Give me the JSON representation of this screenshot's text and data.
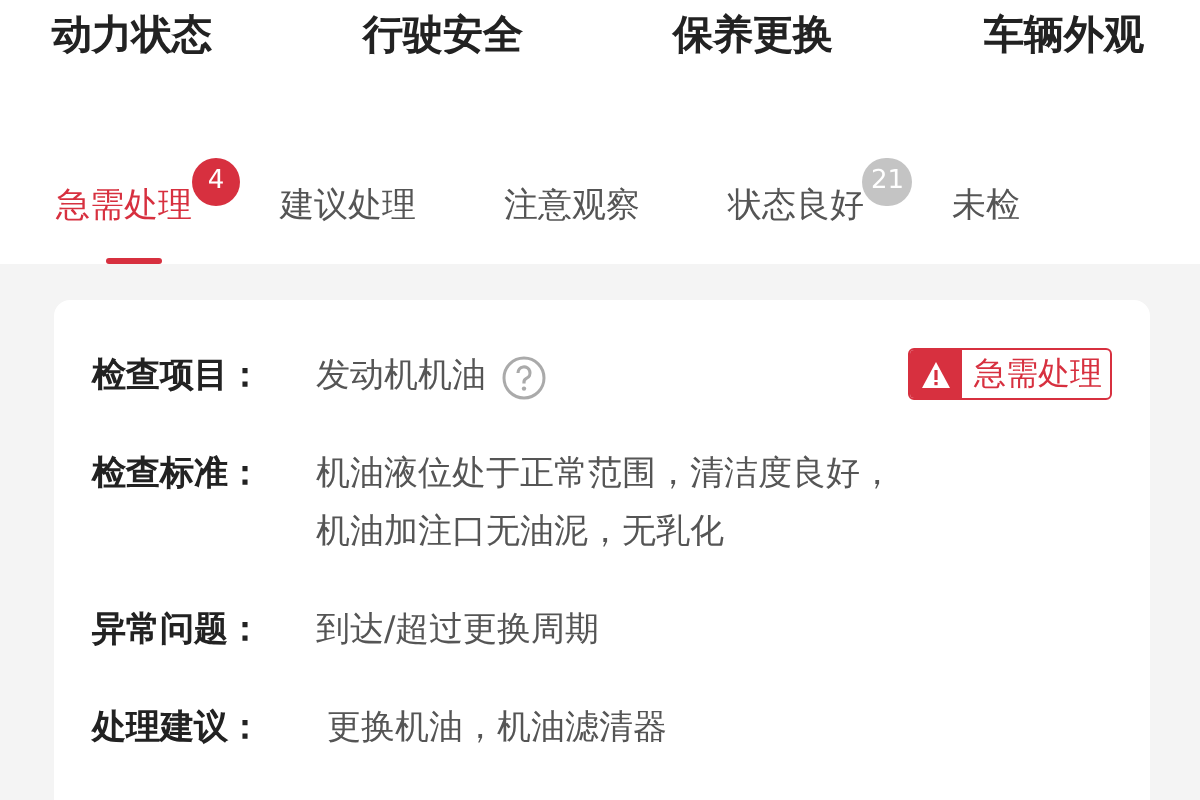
{
  "categories": [
    {
      "label": "动力状态"
    },
    {
      "label": "行驶安全"
    },
    {
      "label": "保养更换"
    },
    {
      "label": "车辆外观"
    }
  ],
  "tabs": [
    {
      "label": "急需处理",
      "selected": true,
      "badge": {
        "text": "4",
        "color": "#d7303f"
      }
    },
    {
      "label": "建议处理",
      "selected": false
    },
    {
      "label": "注意观察",
      "selected": false
    },
    {
      "label": "状态良好",
      "selected": false,
      "badge": {
        "text": "21",
        "color": "#c4c4c4"
      }
    },
    {
      "label": "未检",
      "selected": false
    }
  ],
  "card": {
    "status_tag": "急需处理",
    "rows": [
      {
        "kind": "item",
        "label": "检查项目：",
        "lines": [
          "发动机机油"
        ],
        "help": true
      },
      {
        "kind": "text",
        "label": "检查标准：",
        "lines": [
          "机油液位处于正常范围，清洁度良好，",
          "机油加注口无油泥，无乳化"
        ]
      },
      {
        "kind": "text",
        "label": "异常问题：",
        "lines": [
          "到达/超过更换周期"
        ]
      },
      {
        "kind": "text",
        "label": "处理建议：",
        "lines": [
          " 更换机油，机油滤清器"
        ]
      }
    ]
  }
}
